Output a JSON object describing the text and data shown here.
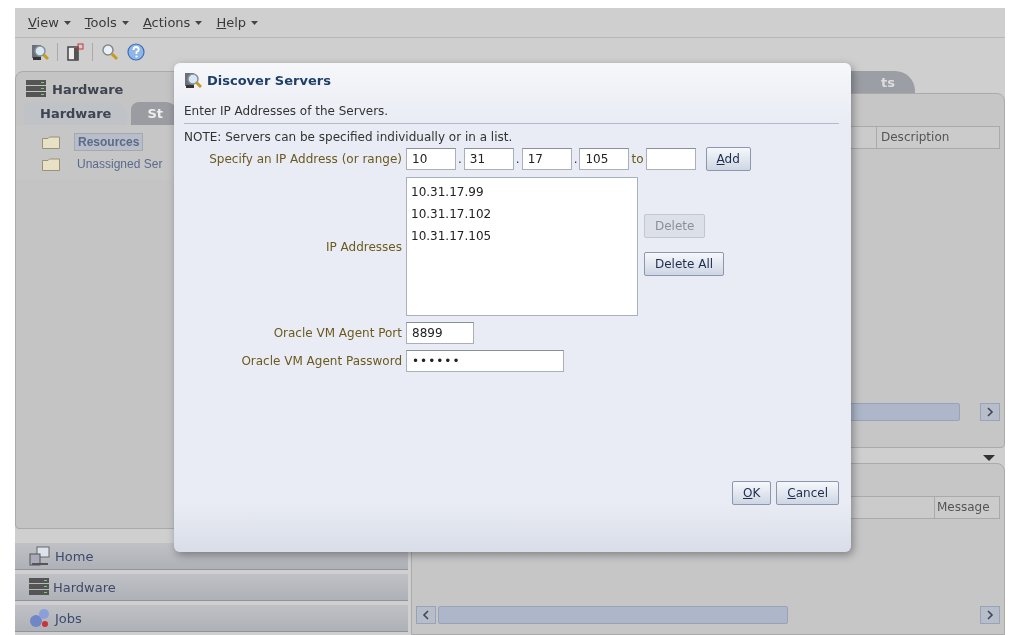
{
  "menu": [
    {
      "label": "View"
    },
    {
      "label": "Tools"
    },
    {
      "label": "Actions"
    },
    {
      "label": "Help"
    }
  ],
  "left_panel": {
    "title": "Hardware",
    "tabs": [
      {
        "label": "Hardware",
        "selected": true
      },
      {
        "label": "St",
        "selected": false
      }
    ],
    "tree": [
      {
        "label": "Resources",
        "selected": true
      },
      {
        "label": "Unassigned Ser",
        "selected": false
      }
    ]
  },
  "accordion": [
    {
      "label": "Home",
      "kind": "home"
    },
    {
      "label": "Hardware",
      "kind": "hardware"
    },
    {
      "label": "Jobs",
      "kind": "jobs"
    }
  ],
  "right_panel": {
    "tab": "ts",
    "columns": [
      "Description"
    ]
  },
  "lower_panel": {
    "columns": [
      "Message"
    ]
  },
  "dialog": {
    "title": "Discover Servers",
    "instruction": "Enter IP Addresses of the Servers.",
    "note": "NOTE: Servers can be specified individually or in a list.",
    "ip_label": "Specify an IP Address (or range)",
    "octets": [
      "10",
      "31",
      "17",
      "105"
    ],
    "separators": [
      ".",
      ".",
      "."
    ],
    "range_to": "to",
    "add_button": "Add",
    "list_label": "IP Addresses",
    "addresses": [
      "10.31.17.99",
      "10.31.17.102",
      "10.31.17.105"
    ],
    "list_buttons": [
      {
        "label": "Delete",
        "disabled": true
      },
      {
        "label": "Delete All",
        "disabled": false
      }
    ],
    "port_label": "Oracle VM Agent Port",
    "port": "8899",
    "password_label": "Oracle VM Agent Password",
    "password": "••••••",
    "ok_button": "OK",
    "cancel_button": "Cancel"
  }
}
